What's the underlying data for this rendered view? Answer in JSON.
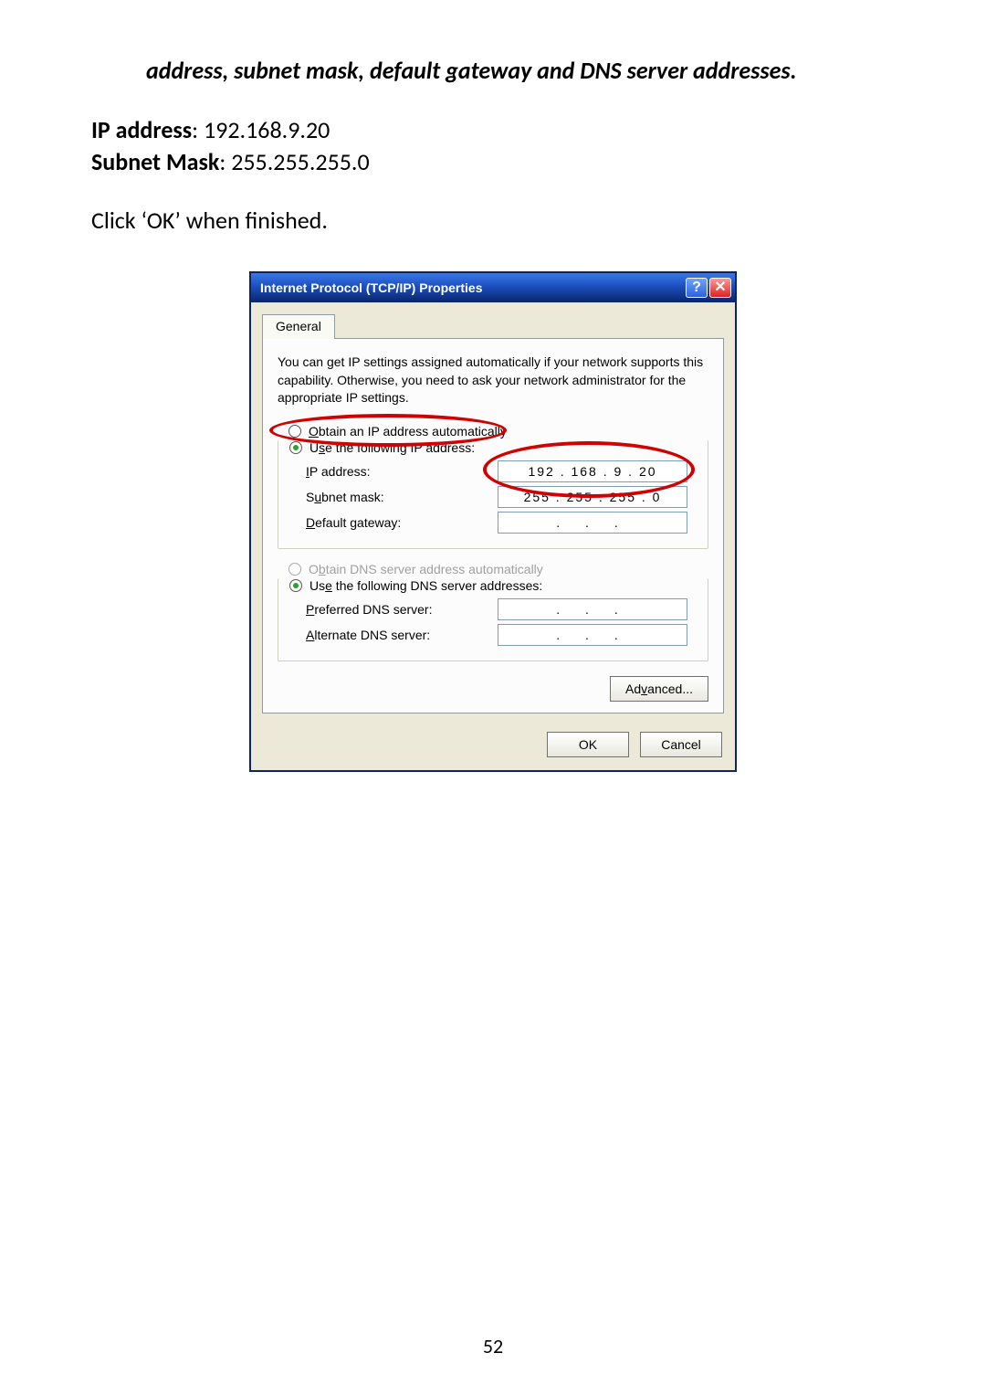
{
  "doc": {
    "italic_note": "address, subnet mask, default gateway and DNS server addresses.",
    "ip_label": "IP address",
    "ip_value": ": 192.168.9.20",
    "mask_label": "Subnet Mask",
    "mask_value": ": 255.255.255.0",
    "click_ok": "Click ‘OK’ when finished.",
    "page_number": "52"
  },
  "dialog": {
    "title": "Internet Protocol (TCP/IP) Properties",
    "help_glyph": "?",
    "close_glyph": "✕",
    "tab": "General",
    "description": "You can get IP settings assigned automatically if your network supports this capability. Otherwise, you need to ask your network administrator for the appropriate IP settings.",
    "radio_obtain_ip": "Obtain an IP address automatically",
    "radio_use_ip": "Use the following IP address:",
    "ip_address_label": "IP address:",
    "ip_address_value": "192 . 168 .  9  . 20",
    "subnet_label": "Subnet mask:",
    "subnet_value": "255 . 255 . 255 .  0",
    "gateway_label": "Default gateway:",
    "gateway_value": ".      .      .",
    "radio_obtain_dns": "Obtain DNS server address automatically",
    "radio_use_dns": "Use the following DNS server addresses:",
    "pref_dns_label": "Preferred DNS server:",
    "pref_dns_value": ".      .      .",
    "alt_dns_label": "Alternate DNS server:",
    "alt_dns_value": ".      .      .",
    "advanced_label": "Advanced...",
    "ok_label": "OK",
    "cancel_label": "Cancel"
  }
}
